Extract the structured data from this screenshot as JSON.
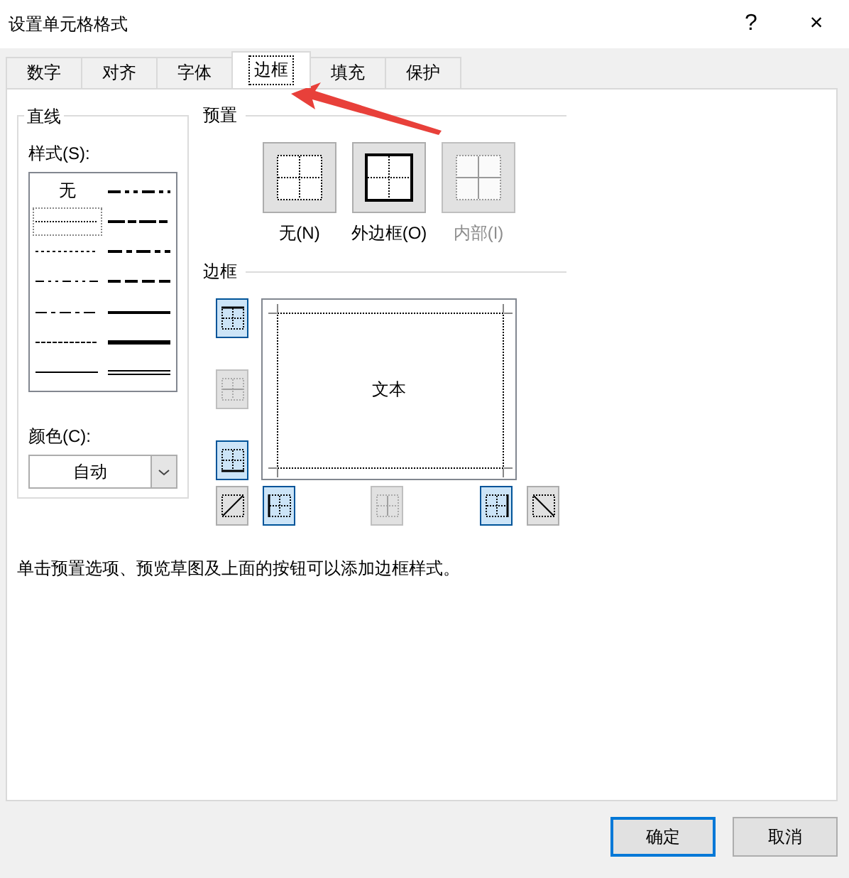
{
  "window": {
    "title": "设置单元格格式",
    "help": "?",
    "close": "×"
  },
  "tabs": [
    {
      "label": "数字",
      "selected": false
    },
    {
      "label": "对齐",
      "selected": false
    },
    {
      "label": "字体",
      "selected": false
    },
    {
      "label": "边框",
      "selected": true
    },
    {
      "label": "填充",
      "selected": false
    },
    {
      "label": "保护",
      "selected": false
    }
  ],
  "line": {
    "title": "直线",
    "style_label": "样式(S):",
    "styles": [
      {
        "kind": "none",
        "label": "无",
        "selected": false
      },
      {
        "kind": "hair",
        "selected": true
      },
      {
        "kind": "dotted",
        "selected": false
      },
      {
        "kind": "dash-dot-dot",
        "selected": false
      },
      {
        "kind": "dash-dot",
        "selected": false
      },
      {
        "kind": "dashed",
        "selected": false
      },
      {
        "kind": "thin",
        "selected": false
      },
      {
        "kind": "medium-dash-dot-dot",
        "selected": false
      },
      {
        "kind": "slant-dash-dot",
        "selected": false
      },
      {
        "kind": "medium-dash-dot",
        "selected": false
      },
      {
        "kind": "medium-dashed",
        "selected": false
      },
      {
        "kind": "medium",
        "selected": false
      },
      {
        "kind": "thick",
        "selected": false
      },
      {
        "kind": "double",
        "selected": false
      }
    ],
    "color_label": "颜色(C):",
    "color_value": "自动"
  },
  "presets": {
    "title": "预置",
    "items": [
      {
        "kind": "none",
        "label": "无(N)",
        "disabled": false
      },
      {
        "kind": "outline",
        "label": "外边框(O)",
        "disabled": false
      },
      {
        "kind": "inside",
        "label": "内部(I)",
        "disabled": true
      }
    ]
  },
  "border": {
    "title": "边框",
    "preview_text": "文本",
    "side_buttons": [
      {
        "kind": "top",
        "on": true,
        "disabled": false
      },
      {
        "kind": "middle-horizontal",
        "on": false,
        "disabled": true
      },
      {
        "kind": "bottom",
        "on": true,
        "disabled": false
      }
    ],
    "bottom_buttons": [
      {
        "kind": "diagonal-up",
        "on": false,
        "disabled": false
      },
      {
        "kind": "left",
        "on": true,
        "disabled": false
      },
      {
        "kind": "middle-vertical",
        "on": false,
        "disabled": true
      },
      {
        "kind": "right",
        "on": true,
        "disabled": false
      },
      {
        "kind": "diagonal-down",
        "on": false,
        "disabled": false
      }
    ]
  },
  "hint": "单击预置选项、预览草图及上面的按钮可以添加边框样式。",
  "buttons": [
    {
      "label": "确定",
      "kind": "default"
    },
    {
      "label": "取消",
      "kind": "normal"
    }
  ]
}
